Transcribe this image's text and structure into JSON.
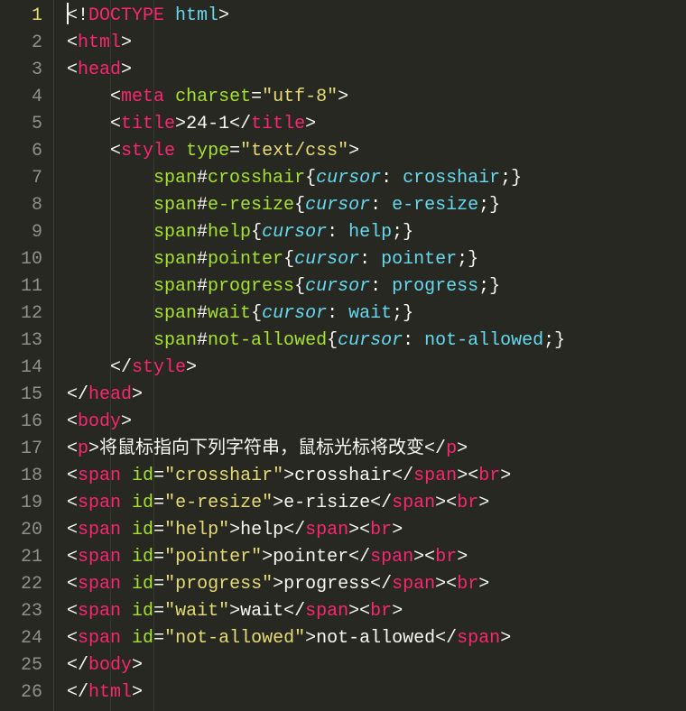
{
  "gutter": {
    "numbers": [
      1,
      2,
      3,
      4,
      5,
      6,
      7,
      8,
      9,
      10,
      11,
      12,
      13,
      14,
      15,
      16,
      17,
      18,
      19,
      20,
      21,
      22,
      23,
      24,
      25,
      26
    ],
    "activeLine": 1
  },
  "code": {
    "lines": [
      {
        "indent": 0,
        "cursor": true,
        "tokens": [
          {
            "t": "punc",
            "v": "<!"
          },
          {
            "t": "doctype",
            "v": "DOCTYPE "
          },
          {
            "t": "html",
            "v": "html"
          },
          {
            "t": "punc",
            "v": ">"
          }
        ]
      },
      {
        "indent": 0,
        "tokens": [
          {
            "t": "punc",
            "v": "<"
          },
          {
            "t": "tag",
            "v": "html"
          },
          {
            "t": "punc",
            "v": ">"
          }
        ]
      },
      {
        "indent": 0,
        "tokens": [
          {
            "t": "punc",
            "v": "<"
          },
          {
            "t": "tag",
            "v": "head"
          },
          {
            "t": "punc",
            "v": ">"
          }
        ]
      },
      {
        "indent": 1,
        "tokens": [
          {
            "t": "punc",
            "v": "<"
          },
          {
            "t": "tag",
            "v": "meta"
          },
          {
            "t": "text",
            "v": " "
          },
          {
            "t": "attr",
            "v": "charset"
          },
          {
            "t": "punc",
            "v": "="
          },
          {
            "t": "str",
            "v": "\"utf-8\""
          },
          {
            "t": "punc",
            "v": ">"
          }
        ]
      },
      {
        "indent": 1,
        "tokens": [
          {
            "t": "punc",
            "v": "<"
          },
          {
            "t": "tag",
            "v": "title"
          },
          {
            "t": "punc",
            "v": ">"
          },
          {
            "t": "text",
            "v": "24-1"
          },
          {
            "t": "punc",
            "v": "</"
          },
          {
            "t": "tag",
            "v": "title"
          },
          {
            "t": "punc",
            "v": ">"
          }
        ]
      },
      {
        "indent": 1,
        "tokens": [
          {
            "t": "punc",
            "v": "<"
          },
          {
            "t": "tag",
            "v": "style"
          },
          {
            "t": "text",
            "v": " "
          },
          {
            "t": "attr",
            "v": "type"
          },
          {
            "t": "punc",
            "v": "="
          },
          {
            "t": "str",
            "v": "\"text/css\""
          },
          {
            "t": "punc",
            "v": ">"
          }
        ]
      },
      {
        "indent": 2,
        "tokens": [
          {
            "t": "sel",
            "v": "span"
          },
          {
            "t": "punc",
            "v": "#"
          },
          {
            "t": "attr",
            "v": "crosshair"
          },
          {
            "t": "punc",
            "v": "{"
          },
          {
            "t": "prop",
            "v": "cursor"
          },
          {
            "t": "punc",
            "v": ": "
          },
          {
            "t": "val",
            "v": "crosshair"
          },
          {
            "t": "punc",
            "v": ";}"
          }
        ]
      },
      {
        "indent": 2,
        "tokens": [
          {
            "t": "sel",
            "v": "span"
          },
          {
            "t": "punc",
            "v": "#"
          },
          {
            "t": "attr",
            "v": "e-resize"
          },
          {
            "t": "punc",
            "v": "{"
          },
          {
            "t": "prop",
            "v": "cursor"
          },
          {
            "t": "punc",
            "v": ": "
          },
          {
            "t": "val",
            "v": "e-resize"
          },
          {
            "t": "punc",
            "v": ";}"
          }
        ]
      },
      {
        "indent": 2,
        "tokens": [
          {
            "t": "sel",
            "v": "span"
          },
          {
            "t": "punc",
            "v": "#"
          },
          {
            "t": "attr",
            "v": "help"
          },
          {
            "t": "punc",
            "v": "{"
          },
          {
            "t": "prop",
            "v": "cursor"
          },
          {
            "t": "punc",
            "v": ": "
          },
          {
            "t": "val",
            "v": "help"
          },
          {
            "t": "punc",
            "v": ";}"
          }
        ]
      },
      {
        "indent": 2,
        "tokens": [
          {
            "t": "sel",
            "v": "span"
          },
          {
            "t": "punc",
            "v": "#"
          },
          {
            "t": "attr",
            "v": "pointer"
          },
          {
            "t": "punc",
            "v": "{"
          },
          {
            "t": "prop",
            "v": "cursor"
          },
          {
            "t": "punc",
            "v": ": "
          },
          {
            "t": "val",
            "v": "pointer"
          },
          {
            "t": "punc",
            "v": ";}"
          }
        ]
      },
      {
        "indent": 2,
        "tokens": [
          {
            "t": "sel",
            "v": "span"
          },
          {
            "t": "punc",
            "v": "#"
          },
          {
            "t": "attr",
            "v": "progress"
          },
          {
            "t": "punc",
            "v": "{"
          },
          {
            "t": "prop",
            "v": "cursor"
          },
          {
            "t": "punc",
            "v": ": "
          },
          {
            "t": "val",
            "v": "progress"
          },
          {
            "t": "punc",
            "v": ";}"
          }
        ]
      },
      {
        "indent": 2,
        "tokens": [
          {
            "t": "sel",
            "v": "span"
          },
          {
            "t": "punc",
            "v": "#"
          },
          {
            "t": "attr",
            "v": "wait"
          },
          {
            "t": "punc",
            "v": "{"
          },
          {
            "t": "prop",
            "v": "cursor"
          },
          {
            "t": "punc",
            "v": ": "
          },
          {
            "t": "val",
            "v": "wait"
          },
          {
            "t": "punc",
            "v": ";}"
          }
        ]
      },
      {
        "indent": 2,
        "tokens": [
          {
            "t": "sel",
            "v": "span"
          },
          {
            "t": "punc",
            "v": "#"
          },
          {
            "t": "attr",
            "v": "not-allowed"
          },
          {
            "t": "punc",
            "v": "{"
          },
          {
            "t": "prop",
            "v": "cursor"
          },
          {
            "t": "punc",
            "v": ": "
          },
          {
            "t": "val",
            "v": "not-allowed"
          },
          {
            "t": "punc",
            "v": ";}"
          }
        ]
      },
      {
        "indent": 1,
        "tokens": [
          {
            "t": "punc",
            "v": "</"
          },
          {
            "t": "tag",
            "v": "style"
          },
          {
            "t": "punc",
            "v": ">"
          }
        ]
      },
      {
        "indent": 0,
        "tokens": [
          {
            "t": "punc",
            "v": "</"
          },
          {
            "t": "tag",
            "v": "head"
          },
          {
            "t": "punc",
            "v": ">"
          }
        ]
      },
      {
        "indent": 0,
        "tokens": [
          {
            "t": "punc",
            "v": "<"
          },
          {
            "t": "tag",
            "v": "body"
          },
          {
            "t": "punc",
            "v": ">"
          }
        ]
      },
      {
        "indent": 0,
        "tokens": [
          {
            "t": "punc",
            "v": "<"
          },
          {
            "t": "tag",
            "v": "p"
          },
          {
            "t": "punc",
            "v": ">"
          },
          {
            "t": "text",
            "v": "将鼠标指向下列字符串，鼠标光标将改变"
          },
          {
            "t": "punc",
            "v": "</"
          },
          {
            "t": "tag",
            "v": "p"
          },
          {
            "t": "punc",
            "v": ">"
          }
        ]
      },
      {
        "indent": 0,
        "tokens": [
          {
            "t": "punc",
            "v": "<"
          },
          {
            "t": "tag",
            "v": "span"
          },
          {
            "t": "text",
            "v": " "
          },
          {
            "t": "attr",
            "v": "id"
          },
          {
            "t": "punc",
            "v": "="
          },
          {
            "t": "str",
            "v": "\"crosshair\""
          },
          {
            "t": "punc",
            "v": ">"
          },
          {
            "t": "text",
            "v": "crosshair"
          },
          {
            "t": "punc",
            "v": "</"
          },
          {
            "t": "tag",
            "v": "span"
          },
          {
            "t": "punc",
            "v": "><"
          },
          {
            "t": "tag",
            "v": "br"
          },
          {
            "t": "punc",
            "v": ">"
          }
        ]
      },
      {
        "indent": 0,
        "tokens": [
          {
            "t": "punc",
            "v": "<"
          },
          {
            "t": "tag",
            "v": "span"
          },
          {
            "t": "text",
            "v": " "
          },
          {
            "t": "attr",
            "v": "id"
          },
          {
            "t": "punc",
            "v": "="
          },
          {
            "t": "str",
            "v": "\"e-resize\""
          },
          {
            "t": "punc",
            "v": ">"
          },
          {
            "t": "text",
            "v": "e-risize"
          },
          {
            "t": "punc",
            "v": "</"
          },
          {
            "t": "tag",
            "v": "span"
          },
          {
            "t": "punc",
            "v": "><"
          },
          {
            "t": "tag",
            "v": "br"
          },
          {
            "t": "punc",
            "v": ">"
          }
        ]
      },
      {
        "indent": 0,
        "tokens": [
          {
            "t": "punc",
            "v": "<"
          },
          {
            "t": "tag",
            "v": "span"
          },
          {
            "t": "text",
            "v": " "
          },
          {
            "t": "attr",
            "v": "id"
          },
          {
            "t": "punc",
            "v": "="
          },
          {
            "t": "str",
            "v": "\"help\""
          },
          {
            "t": "punc",
            "v": ">"
          },
          {
            "t": "text",
            "v": "help"
          },
          {
            "t": "punc",
            "v": "</"
          },
          {
            "t": "tag",
            "v": "span"
          },
          {
            "t": "punc",
            "v": "><"
          },
          {
            "t": "tag",
            "v": "br"
          },
          {
            "t": "punc",
            "v": ">"
          }
        ]
      },
      {
        "indent": 0,
        "tokens": [
          {
            "t": "punc",
            "v": "<"
          },
          {
            "t": "tag",
            "v": "span"
          },
          {
            "t": "text",
            "v": " "
          },
          {
            "t": "attr",
            "v": "id"
          },
          {
            "t": "punc",
            "v": "="
          },
          {
            "t": "str",
            "v": "\"pointer\""
          },
          {
            "t": "punc",
            "v": ">"
          },
          {
            "t": "text",
            "v": "pointer"
          },
          {
            "t": "punc",
            "v": "</"
          },
          {
            "t": "tag",
            "v": "span"
          },
          {
            "t": "punc",
            "v": "><"
          },
          {
            "t": "tag",
            "v": "br"
          },
          {
            "t": "punc",
            "v": ">"
          }
        ]
      },
      {
        "indent": 0,
        "tokens": [
          {
            "t": "punc",
            "v": "<"
          },
          {
            "t": "tag",
            "v": "span"
          },
          {
            "t": "text",
            "v": " "
          },
          {
            "t": "attr",
            "v": "id"
          },
          {
            "t": "punc",
            "v": "="
          },
          {
            "t": "str",
            "v": "\"progress\""
          },
          {
            "t": "punc",
            "v": ">"
          },
          {
            "t": "text",
            "v": "progress"
          },
          {
            "t": "punc",
            "v": "</"
          },
          {
            "t": "tag",
            "v": "span"
          },
          {
            "t": "punc",
            "v": "><"
          },
          {
            "t": "tag",
            "v": "br"
          },
          {
            "t": "punc",
            "v": ">"
          }
        ]
      },
      {
        "indent": 0,
        "tokens": [
          {
            "t": "punc",
            "v": "<"
          },
          {
            "t": "tag",
            "v": "span"
          },
          {
            "t": "text",
            "v": " "
          },
          {
            "t": "attr",
            "v": "id"
          },
          {
            "t": "punc",
            "v": "="
          },
          {
            "t": "str",
            "v": "\"wait\""
          },
          {
            "t": "punc",
            "v": ">"
          },
          {
            "t": "text",
            "v": "wait"
          },
          {
            "t": "punc",
            "v": "</"
          },
          {
            "t": "tag",
            "v": "span"
          },
          {
            "t": "punc",
            "v": "><"
          },
          {
            "t": "tag",
            "v": "br"
          },
          {
            "t": "punc",
            "v": ">"
          }
        ]
      },
      {
        "indent": 0,
        "tokens": [
          {
            "t": "punc",
            "v": "<"
          },
          {
            "t": "tag",
            "v": "span"
          },
          {
            "t": "text",
            "v": " "
          },
          {
            "t": "attr",
            "v": "id"
          },
          {
            "t": "punc",
            "v": "="
          },
          {
            "t": "str",
            "v": "\"not-allowed\""
          },
          {
            "t": "punc",
            "v": ">"
          },
          {
            "t": "text",
            "v": "not-allowed"
          },
          {
            "t": "punc",
            "v": "</"
          },
          {
            "t": "tag",
            "v": "span"
          },
          {
            "t": "punc",
            "v": ">"
          }
        ]
      },
      {
        "indent": 0,
        "tokens": [
          {
            "t": "punc",
            "v": "</"
          },
          {
            "t": "tag",
            "v": "body"
          },
          {
            "t": "punc",
            "v": ">"
          }
        ]
      },
      {
        "indent": 0,
        "tokens": [
          {
            "t": "punc",
            "v": "</"
          },
          {
            "t": "tag",
            "v": "html"
          },
          {
            "t": "punc",
            "v": ">"
          }
        ]
      }
    ]
  },
  "indentUnit": "    "
}
